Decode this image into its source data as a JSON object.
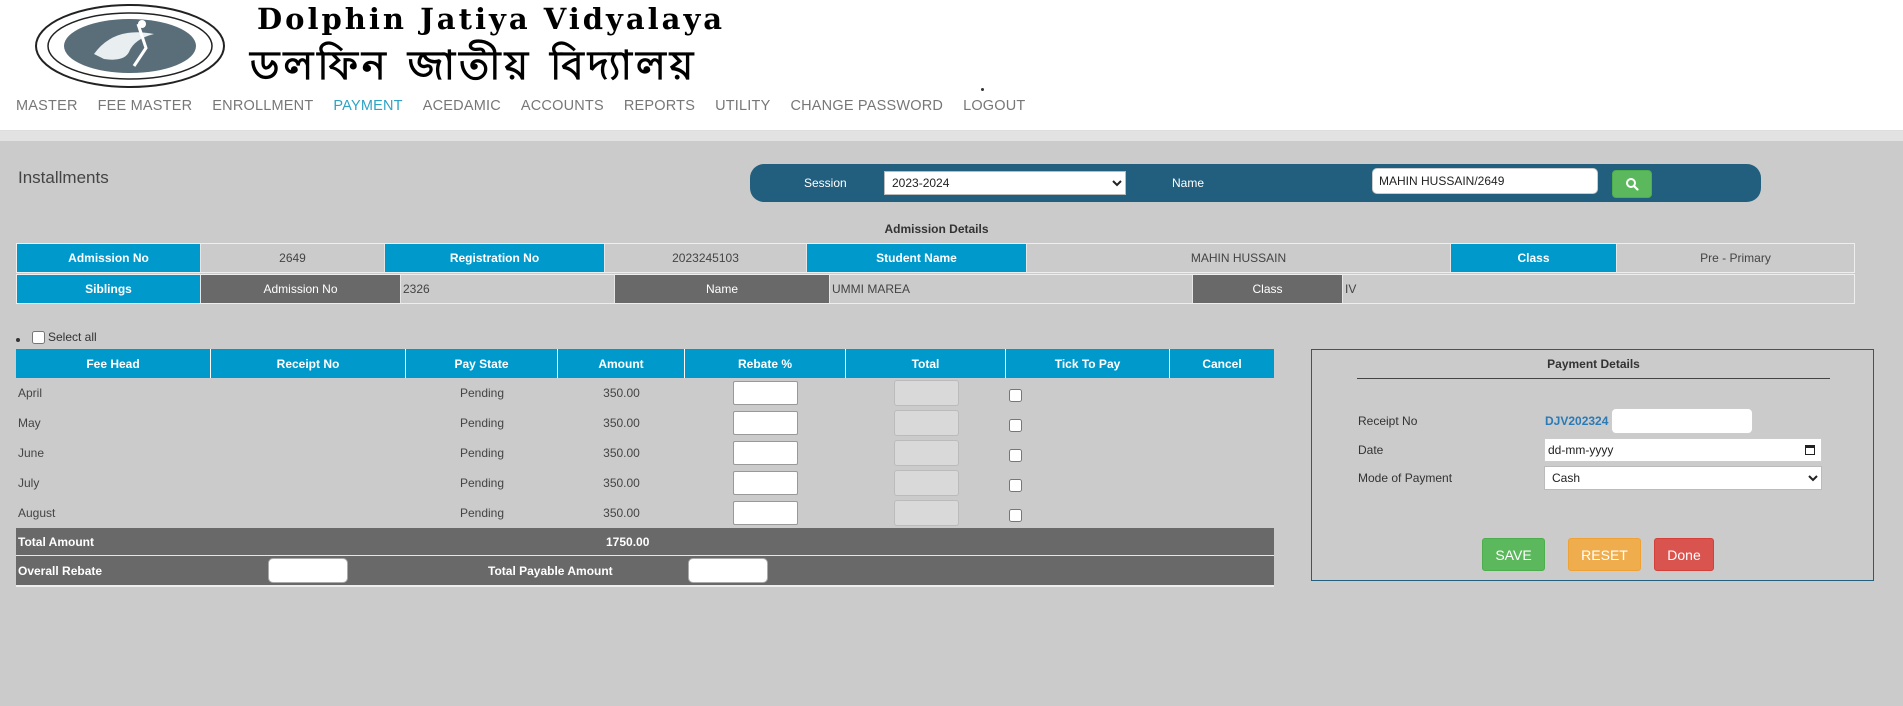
{
  "header": {
    "title_en": "Dolphin Jatiya Vidyalaya",
    "title_bn": "ডলফিন জাতীয় বিদ্যালয়"
  },
  "nav": {
    "items": [
      {
        "label": "MASTER"
      },
      {
        "label": "FEE MASTER"
      },
      {
        "label": "ENROLLMENT"
      },
      {
        "label": "PAYMENT",
        "active": true
      },
      {
        "label": "ACEDAMIC"
      },
      {
        "label": "ACCOUNTS"
      },
      {
        "label": "REPORTS"
      },
      {
        "label": "UTILITY"
      },
      {
        "label": "CHANGE PASSWORD"
      },
      {
        "label": "LOGOUT"
      }
    ],
    "active_color": "#2ea3c5"
  },
  "page": {
    "title": "Installments"
  },
  "search": {
    "session_label": "Session",
    "session_value": "2023-2024",
    "name_label": "Name",
    "name_value": "MAHIN HUSSAIN/2649",
    "bar_color": "#225f7e"
  },
  "admission": {
    "title": "Admission Details",
    "admission_no_label": "Admission No",
    "admission_no": "2649",
    "registration_no_label": "Registration No",
    "registration_no": "2023245103",
    "student_name_label": "Student Name",
    "student_name": "MAHIN HUSSAIN",
    "class_label": "Class",
    "class": "Pre - Primary",
    "siblings_label": "Siblings",
    "sibling": {
      "admission_no_label": "Admission No",
      "admission_no": "2326",
      "name_label": "Name",
      "name": "UMMI MAREA",
      "class_label": "Class",
      "class": "IV"
    }
  },
  "installments": {
    "select_all_label": "Select all",
    "headers": [
      "Fee Head",
      "Receipt No",
      "Pay State",
      "Amount",
      "Rebate %",
      "Total",
      "Tick To Pay",
      "Cancel"
    ],
    "rows": [
      {
        "fee_head": "April",
        "receipt_no": "",
        "pay_state": "Pending",
        "amount": "350.00"
      },
      {
        "fee_head": "May",
        "receipt_no": "",
        "pay_state": "Pending",
        "amount": "350.00"
      },
      {
        "fee_head": "June",
        "receipt_no": "",
        "pay_state": "Pending",
        "amount": "350.00"
      },
      {
        "fee_head": "July",
        "receipt_no": "",
        "pay_state": "Pending",
        "amount": "350.00"
      },
      {
        "fee_head": "August",
        "receipt_no": "",
        "pay_state": "Pending",
        "amount": "350.00"
      }
    ],
    "total_amount_label": "Total Amount",
    "total_amount": "1750.00",
    "overall_rebate_label": "Overall Rebate",
    "total_payable_label": "Total Payable Amount"
  },
  "payment": {
    "title": "Payment Details",
    "receipt_no_label": "Receipt No",
    "receipt_prefix": "DJV202324",
    "date_label": "Date",
    "date_placeholder": "dd-mm-yyyy",
    "mode_label": "Mode of Payment",
    "mode_value": "Cash",
    "save_label": "SAVE",
    "reset_label": "RESET",
    "done_label": "Done"
  },
  "colors": {
    "header_blue": "#0099cc",
    "gray_cell": "#696969",
    "save": "#5cb85c",
    "reset": "#f0ad4e",
    "done": "#d9534f"
  }
}
